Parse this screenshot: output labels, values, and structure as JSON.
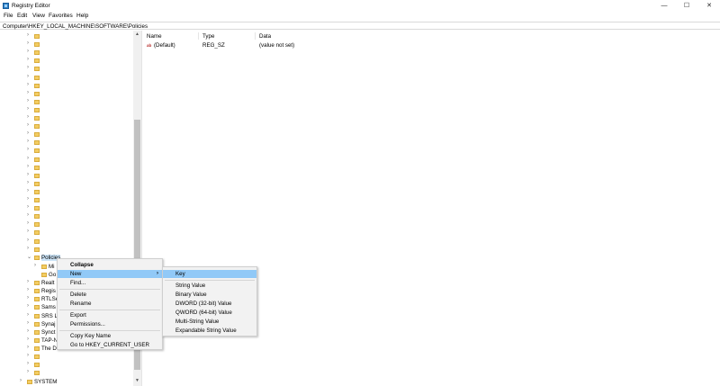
{
  "window": {
    "title": "Registry Editor",
    "minimize_glyph": "—",
    "maximize_glyph": "☐",
    "close_glyph": "✕"
  },
  "menu": [
    "File",
    "Edit",
    "View",
    "Favorites",
    "Help"
  ],
  "address": "Computer\\HKEY_LOCAL_MACHINE\\SOFTWARE\\Policies",
  "tree": {
    "partial_labels": [
      {
        "label": "Policies",
        "selected": true
      },
      {
        "label": "Mi"
      },
      {
        "label": "Go"
      },
      {
        "label": "Realt"
      },
      {
        "label": "Regis"
      },
      {
        "label": "RTLSe"
      },
      {
        "label": "Sams"
      },
      {
        "label": "SRS L"
      },
      {
        "label": "Synaj"
      },
      {
        "label": "Synct"
      },
      {
        "label": "TAP-N"
      },
      {
        "label": "The Document Foundation"
      }
    ],
    "bottom_label": "SYSTEM"
  },
  "list": {
    "columns": [
      "Name",
      "Type",
      "Data"
    ],
    "rows": [
      {
        "icon": "ab",
        "name": "(Default)",
        "type": "REG_SZ",
        "data": "(value not set)"
      }
    ]
  },
  "context_menu": {
    "items": [
      "Collapse",
      "New",
      "Find...",
      "Delete",
      "Rename",
      "Export",
      "Permissions...",
      "Copy Key Name",
      "Go to HKEY_CURRENT_USER"
    ],
    "submenu_arrow": "›"
  },
  "new_submenu": {
    "items": [
      "Key",
      "String Value",
      "Binary Value",
      "DWORD (32-bit) Value",
      "QWORD (64-bit) Value",
      "Multi-String Value",
      "Expandable String Value"
    ]
  },
  "icons": {
    "expand": "›",
    "collapse": "⌄",
    "scroll_up": "▲",
    "scroll_down": "▼"
  }
}
